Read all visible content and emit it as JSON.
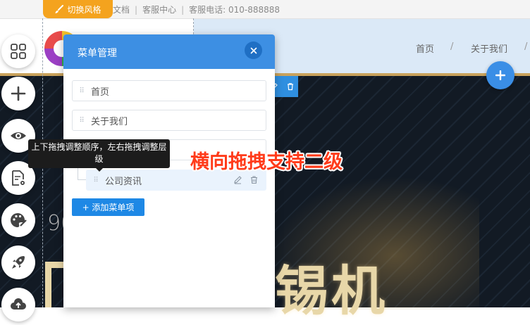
{
  "topbar": {
    "style_switch_label": "切换风格",
    "doc_text": "文档",
    "service_center": "客服中心",
    "service_phone": "客服电话: 010-888888"
  },
  "header": {
    "nav": [
      "首页",
      "关于我们"
    ],
    "nav_sep": "/"
  },
  "banner": {
    "number_fragment": "90",
    "title_fragment": "锡机"
  },
  "menu_panel": {
    "title": "菜单管理",
    "items": [
      {
        "label": "首页"
      },
      {
        "label": "关于我们"
      },
      {
        "label": ""
      }
    ],
    "child_item": {
      "label": "公司资讯"
    },
    "add_button": "+ 添加菜单项"
  },
  "tooltip": {
    "text": "上下拖拽调整顺序，左右拖拽调整层级"
  },
  "annotation": {
    "text": "横向拖拽支持二级"
  },
  "colors": {
    "accent_blue": "#3d8fe3",
    "style_switch_orange": "#f4a31e",
    "annotation_red": "#ff3b1a",
    "header_blue": "#dbe9f7"
  },
  "icons": {
    "left_toolbar": [
      "grid-icon",
      "plus-icon",
      "eye-icon",
      "page-settings-icon",
      "palette-icon",
      "rocket-icon",
      "cloud-upload-icon"
    ]
  }
}
